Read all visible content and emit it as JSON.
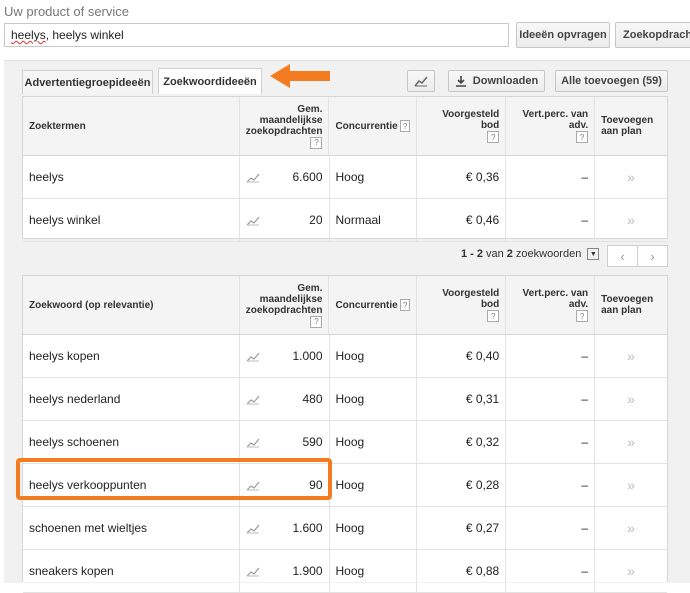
{
  "form": {
    "label": "Uw product of service",
    "input_value_part1": "heelys",
    "input_value_part2": ", heelys winkel"
  },
  "buttons": {
    "ideas": "Ideeën opvragen",
    "search": "Zoekopdracht"
  },
  "tabs": {
    "adgroup": "Advertentiegroepideeën",
    "keyword": "Zoekwoordideeën"
  },
  "toolbar": {
    "download": "Downloaden",
    "add_all": "Alle toevoegen (59)"
  },
  "headers1": {
    "term": "Zoektermen",
    "monthly": "Gem. maandelijkse zoekopdrachten",
    "competition": "Concurrentie",
    "bid": "Voorgesteld bod",
    "share": "Vert.perc. van adv.",
    "add": "Toevoegen aan plan",
    "help": "?"
  },
  "headers2": {
    "term": "Zoekwoord (op relevantie)",
    "monthly": "Gem. maandelijkse zoekopdrachten",
    "competition": "Concurrentie",
    "bid": "Voorgesteld bod",
    "share": "Vert.perc. van adv.",
    "add": "Toevoegen aan plan",
    "help": "?"
  },
  "table1_rows": [
    {
      "term": "heelys",
      "monthly": "6.600",
      "competition": "Hoog",
      "bid": "€ 0,36",
      "share": "–"
    },
    {
      "term": "heelys winkel",
      "monthly": "20",
      "competition": "Normaal",
      "bid": "€ 0,46",
      "share": "–"
    }
  ],
  "pagination": {
    "range": "1 - 2",
    "middle": "van",
    "total": "2",
    "suffix": "zoekwoorden"
  },
  "table2_rows": [
    {
      "term": "heelys kopen",
      "monthly": "1.000",
      "competition": "Hoog",
      "bid": "€ 0,40",
      "share": "–"
    },
    {
      "term": "heelys nederland",
      "monthly": "480",
      "competition": "Hoog",
      "bid": "€ 0,31",
      "share": "–"
    },
    {
      "term": "heelys schoenen",
      "monthly": "590",
      "competition": "Hoog",
      "bid": "€ 0,32",
      "share": "–"
    },
    {
      "term": "heelys verkooppunten",
      "monthly": "90",
      "competition": "Hoog",
      "bid": "€ 0,28",
      "share": "–"
    },
    {
      "term": "schoenen met wieltjes",
      "monthly": "1.600",
      "competition": "Hoog",
      "bid": "€ 0,27",
      "share": "–"
    },
    {
      "term": "sneakers kopen",
      "monthly": "1.900",
      "competition": "Hoog",
      "bid": "€ 0,88",
      "share": "–"
    }
  ],
  "add_glyph": "»",
  "colors": {
    "highlight": "#f47c20"
  }
}
